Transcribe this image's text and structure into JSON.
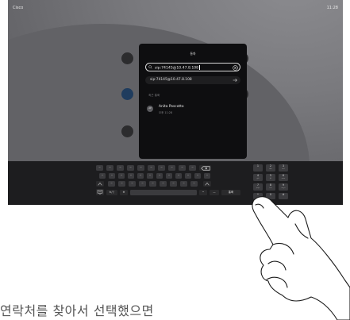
{
  "device": {
    "brand": "Cisco",
    "time": "11:28"
  },
  "dialog": {
    "title": "통화",
    "search_value": "sip:74145@10.47.8.108",
    "suggestion": "sip:74145@10.47.8.108",
    "section_label": "최근 통화",
    "contacts": [
      {
        "initials": "AP",
        "name": "Anita Poscotto",
        "detail": "오후 11:28"
      }
    ]
  },
  "keyboard": {
    "row1": [
      "~",
      "~",
      "~",
      "~",
      "~",
      "~",
      "~",
      "~",
      "~",
      "~"
    ],
    "row2": [
      "~",
      "~",
      "~",
      "~",
      "~",
      "~",
      "~",
      "~",
      "~",
      "~",
      "~",
      "~"
    ],
    "row3": [
      "~",
      "~",
      "~",
      "~",
      "~",
      "~",
      "~",
      "~",
      "~"
    ],
    "bottom": {
      "lang": "ㅎ/ㅏ",
      "globe": "⊕",
      "dot": "•",
      "mic": "",
      "dash": "—",
      "call": "통화"
    },
    "numpad": [
      {
        "digit": "1",
        "letters": ""
      },
      {
        "digit": "2",
        "letters": "abc"
      },
      {
        "digit": "3",
        "letters": "def"
      },
      {
        "digit": "4",
        "letters": "ghi"
      },
      {
        "digit": "5",
        "letters": "jkl"
      },
      {
        "digit": "6",
        "letters": "mno"
      },
      {
        "digit": "7",
        "letters": "pqrs"
      },
      {
        "digit": "8",
        "letters": "tuv"
      },
      {
        "digit": "9",
        "letters": "wxyz"
      },
      {
        "digit": "*",
        "letters": ""
      },
      {
        "digit": "0",
        "letters": ""
      },
      {
        "digit": "#",
        "letters": ""
      }
    ]
  },
  "caption": "연락처를 찾아서 선택했으면",
  "colors": {
    "screen_bg": "#6f6f73",
    "dialog_bg": "#0e0e10",
    "keyboard_bg": "#1d1d1f",
    "key_bg": "#3b3b3e"
  }
}
